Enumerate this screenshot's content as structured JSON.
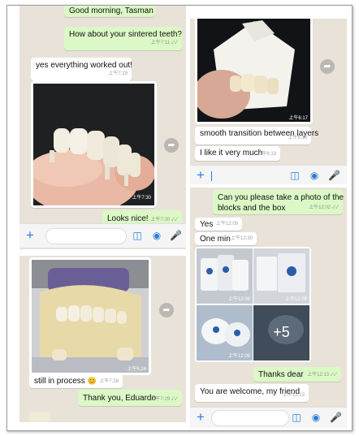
{
  "colors": {
    "chat_background": "#e8e2d9",
    "outgoing_bubble": "#dcf8c6",
    "incoming_bubble": "#ffffff",
    "accent": "#2b7dd6"
  },
  "icons": [
    "plus-icon",
    "sticker-icon",
    "camera-icon",
    "microphone-icon",
    "forward-icon",
    "smile-emoji-icon"
  ],
  "panel1": {
    "msg_good_morning": {
      "text": "Good morning, Tasman"
    },
    "msg_sintered": {
      "text": "How about your sintered teeth?",
      "time": "上午7:11 ✓✓"
    },
    "msg_worked_out": {
      "text": "yes everything worked out!",
      "time": "上午7:29"
    },
    "photo_crown": {
      "time": "上午7:30"
    },
    "msg_looks_nice": {
      "text": "Looks nice!",
      "time": "上午7:30 ✓✓"
    }
  },
  "panel2": {
    "photo_model": {
      "time": "上午5:24"
    },
    "msg_process": {
      "text": "still in process",
      "emoji": "😊",
      "time": "上午7:28"
    },
    "msg_thank": {
      "text": "Thank you, Eduardo",
      "time": "上午7:29 ✓✓"
    }
  },
  "panel3": {
    "photo_tissue": {
      "time": "上午6:17"
    },
    "msg_smooth": {
      "text": "smooth transition between layers",
      "time": "上午6:18"
    },
    "msg_like": {
      "text": "I like it very much",
      "time": "上午6:19"
    }
  },
  "panel4": {
    "msg_request": {
      "line1": "Can you please take a photo of the",
      "line2": "blocks and the box",
      "time": "上午12:02 ✓✓"
    },
    "msg_yes": {
      "text": "Yes",
      "time": "上午12:09"
    },
    "msg_one_min": {
      "text": "One min",
      "time": "上午12:30"
    },
    "gallery": {
      "time1": "上午12:09",
      "time2": "上午12:09",
      "time3": "上午12:09",
      "more_count": "+5"
    },
    "msg_thanks_dear": {
      "text": "Thanks dear",
      "time": "上午12:13 ✓✓"
    },
    "msg_welcome": {
      "text": "You are welcome, my friend",
      "time": "上午12:13"
    }
  }
}
